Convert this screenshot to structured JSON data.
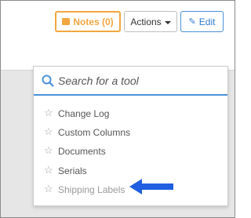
{
  "toolbar": {
    "notes_label": "Notes (0)",
    "actions_label": "Actions",
    "edit_label": "Edit"
  },
  "search": {
    "placeholder": "Search for a tool"
  },
  "tools": [
    {
      "label": "Change Log"
    },
    {
      "label": "Custom Columns"
    },
    {
      "label": "Documents"
    },
    {
      "label": "Serials"
    },
    {
      "label": "Shipping Labels"
    }
  ],
  "icons": {
    "notes": "notes-icon",
    "caret": "chevron-down-icon",
    "edit": "pencil-icon",
    "search": "search-icon",
    "star": "star-outline-icon",
    "arrow": "arrow-left-icon"
  },
  "colors": {
    "notes_accent": "#f2a640",
    "edit_accent": "#2f7bd0",
    "search_accent": "#4a90d9",
    "arrow": "#1f5fe0"
  }
}
